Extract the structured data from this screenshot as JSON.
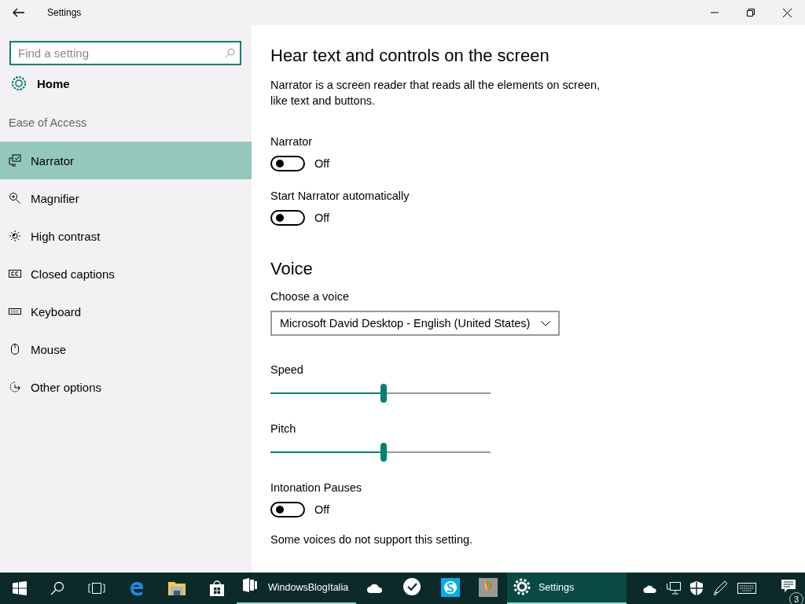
{
  "window": {
    "title": "Settings"
  },
  "sidebar": {
    "search": {
      "placeholder": "Find a setting"
    },
    "home": "Home",
    "section": "Ease of Access",
    "items": [
      {
        "label": "Narrator",
        "selected": true
      },
      {
        "label": "Magnifier",
        "selected": false
      },
      {
        "label": "High contrast",
        "selected": false
      },
      {
        "label": "Closed captions",
        "selected": false
      },
      {
        "label": "Keyboard",
        "selected": false
      },
      {
        "label": "Mouse",
        "selected": false
      },
      {
        "label": "Other options",
        "selected": false
      }
    ]
  },
  "content": [
    {
      "kind": "heading",
      "text": "Hear text and controls on the screen"
    },
    {
      "kind": "text",
      "text": "Narrator is a screen reader that reads all the elements on screen, like text and buttons."
    },
    {
      "kind": "toggle",
      "label": "Narrator",
      "on": false,
      "state_text": "Off"
    },
    {
      "kind": "toggle",
      "label": "Start Narrator automatically",
      "on": false,
      "state_text": "Off"
    },
    {
      "kind": "heading",
      "text": "Voice"
    },
    {
      "kind": "dropdown",
      "label": "Choose a voice",
      "value": "Microsoft David Desktop - English (United States)"
    },
    {
      "kind": "slider",
      "label": "Speed",
      "level": 0.5
    },
    {
      "kind": "slider",
      "label": "Pitch",
      "level": 0.5
    },
    {
      "kind": "toggle",
      "label": "Intonation Pauses",
      "on": false,
      "state_text": "Off"
    },
    {
      "kind": "text",
      "text": "Some voices do not support this setting."
    }
  ],
  "taskbar": {
    "apps": [
      {
        "label": "WindowsBlogItalia",
        "running": true,
        "selected": false
      },
      {
        "running": false,
        "selected": false
      },
      {
        "running": false,
        "selected": false
      },
      {
        "running": false,
        "selected": false
      },
      {
        "running": false,
        "selected": false
      },
      {
        "label": "Settings",
        "running": true,
        "selected": true
      }
    ],
    "notification_count": "3"
  }
}
